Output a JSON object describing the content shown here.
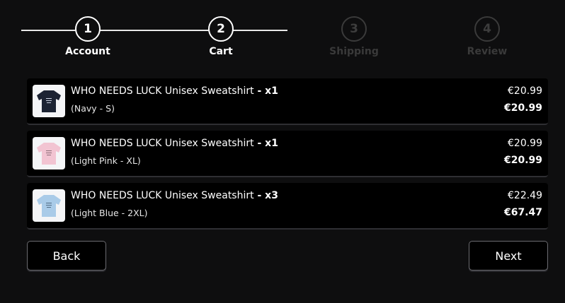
{
  "steps": [
    {
      "number": "1",
      "label": "Account",
      "state": "completed"
    },
    {
      "number": "2",
      "label": "Cart",
      "state": "current"
    },
    {
      "number": "3",
      "label": "Shipping",
      "state": "upcoming"
    },
    {
      "number": "4",
      "label": "Review",
      "state": "upcoming"
    }
  ],
  "cart": {
    "items": [
      {
        "name": "WHO NEEDS LUCK Unisex Sweatshirt",
        "qty": " - x1",
        "variant": "(Navy - S)",
        "unit_price": "€20.99",
        "total_price": "€20.99",
        "thumb_color": "#1c2333",
        "thumb_icon": "navy-sweatshirt-thumbnail"
      },
      {
        "name": "WHO NEEDS LUCK Unisex Sweatshirt",
        "qty": " - x1",
        "variant": "(Light Pink - XL)",
        "unit_price": "€20.99",
        "total_price": "€20.99",
        "thumb_color": "#f2c4d2",
        "thumb_icon": "light-pink-sweatshirt-thumbnail"
      },
      {
        "name": "WHO NEEDS LUCK Unisex Sweatshirt",
        "qty": " - x3",
        "variant": "(Light Blue - 2XL)",
        "unit_price": "€22.49",
        "total_price": "€67.47",
        "thumb_color": "#a9cbe8",
        "thumb_icon": "light-blue-sweatshirt-thumbnail"
      }
    ]
  },
  "actions": {
    "back_label": "Back",
    "next_label": "Next"
  },
  "colors": {
    "background": "#0e0e0f",
    "active": "#ffffff",
    "inactive": "#3a3a3a"
  }
}
